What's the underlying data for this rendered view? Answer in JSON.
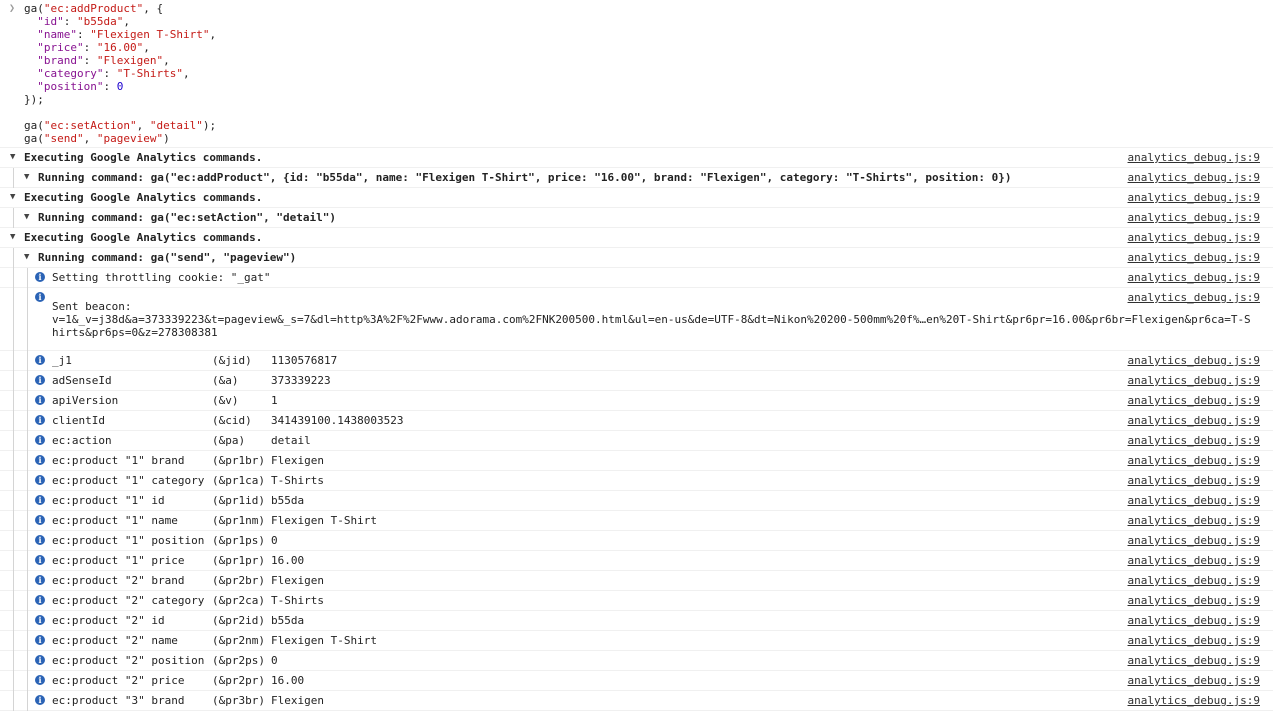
{
  "code_lines": [
    [
      {
        "t": "ga(",
        "c": "plain"
      },
      {
        "t": "\"ec:addProduct\"",
        "c": "str"
      },
      {
        "t": ", {",
        "c": "plain"
      }
    ],
    [
      {
        "t": "  ",
        "c": "plain"
      },
      {
        "t": "\"id\"",
        "c": "key"
      },
      {
        "t": ": ",
        "c": "plain"
      },
      {
        "t": "\"b55da\"",
        "c": "str"
      },
      {
        "t": ",",
        "c": "plain"
      }
    ],
    [
      {
        "t": "  ",
        "c": "plain"
      },
      {
        "t": "\"name\"",
        "c": "key"
      },
      {
        "t": ": ",
        "c": "plain"
      },
      {
        "t": "\"Flexigen T-Shirt\"",
        "c": "str"
      },
      {
        "t": ",",
        "c": "plain"
      }
    ],
    [
      {
        "t": "  ",
        "c": "plain"
      },
      {
        "t": "\"price\"",
        "c": "key"
      },
      {
        "t": ": ",
        "c": "plain"
      },
      {
        "t": "\"16.00\"",
        "c": "str"
      },
      {
        "t": ",",
        "c": "plain"
      }
    ],
    [
      {
        "t": "  ",
        "c": "plain"
      },
      {
        "t": "\"brand\"",
        "c": "key"
      },
      {
        "t": ": ",
        "c": "plain"
      },
      {
        "t": "\"Flexigen\"",
        "c": "str"
      },
      {
        "t": ",",
        "c": "plain"
      }
    ],
    [
      {
        "t": "  ",
        "c": "plain"
      },
      {
        "t": "\"category\"",
        "c": "key"
      },
      {
        "t": ": ",
        "c": "plain"
      },
      {
        "t": "\"T-Shirts\"",
        "c": "str"
      },
      {
        "t": ",",
        "c": "plain"
      }
    ],
    [
      {
        "t": "  ",
        "c": "plain"
      },
      {
        "t": "\"position\"",
        "c": "key"
      },
      {
        "t": ": ",
        "c": "plain"
      },
      {
        "t": "0",
        "c": "num"
      }
    ],
    [
      {
        "t": "});",
        "c": "plain"
      }
    ],
    [
      {
        "t": "",
        "c": "plain"
      }
    ],
    [
      {
        "t": "ga(",
        "c": "plain"
      },
      {
        "t": "\"ec:setAction\"",
        "c": "str"
      },
      {
        "t": ", ",
        "c": "plain"
      },
      {
        "t": "\"detail\"",
        "c": "str"
      },
      {
        "t": ");",
        "c": "plain"
      }
    ],
    [
      {
        "t": "ga(",
        "c": "plain"
      },
      {
        "t": "\"send\"",
        "c": "str"
      },
      {
        "t": ", ",
        "c": "plain"
      },
      {
        "t": "\"pageview\"",
        "c": "str"
      },
      {
        "t": ")",
        "c": "plain"
      }
    ]
  ],
  "source_link": "analytics_debug.js:9",
  "rows": [
    {
      "kind": "group",
      "level": 0,
      "text": "Executing Google Analytics commands."
    },
    {
      "kind": "group",
      "level": 1,
      "text": "Running command: ga(\"ec:addProduct\", {id: \"b55da\", name: \"Flexigen T-Shirt\", price: \"16.00\", brand: \"Flexigen\", category: \"T-Shirts\", position: 0})"
    },
    {
      "kind": "group",
      "level": 0,
      "text": "Executing Google Analytics commands."
    },
    {
      "kind": "group",
      "level": 1,
      "text": "Running command: ga(\"ec:setAction\", \"detail\")"
    },
    {
      "kind": "group",
      "level": 0,
      "text": "Executing Google Analytics commands."
    },
    {
      "kind": "group",
      "level": 1,
      "text": "Running command: ga(\"send\", \"pageview\")"
    },
    {
      "kind": "info",
      "text": "Setting throttling cookie: \"_gat\""
    },
    {
      "kind": "beacon",
      "label": "Sent beacon:",
      "text": "v=1&_v=j38d&a=373339223&t=pageview&_s=7&dl=http%3A%2F%2Fwww.adorama.com%2FNK200500.html&ul=en-us&de=UTF-8&dt=Nikon%20200-500mm%20f%…en%20T-Shirt&pr6pr=16.00&pr6br=Flexigen&pr6ca=T-Shirts&pr6ps=0&z=278308381"
    },
    {
      "kind": "param",
      "name": "_j1",
      "param": "(&jid)",
      "value": "1130576817"
    },
    {
      "kind": "param",
      "name": "adSenseId",
      "param": "(&a)",
      "value": "373339223"
    },
    {
      "kind": "param",
      "name": "apiVersion",
      "param": "(&v)",
      "value": "1"
    },
    {
      "kind": "param",
      "name": "clientId",
      "param": "(&cid)",
      "value": "341439100.1438003523"
    },
    {
      "kind": "param",
      "name": "ec:action",
      "param": "(&pa)",
      "value": "detail"
    },
    {
      "kind": "param",
      "name": "ec:product \"1\" brand",
      "param": "(&pr1br)",
      "value": "Flexigen"
    },
    {
      "kind": "param",
      "name": "ec:product \"1\" category",
      "param": "(&pr1ca)",
      "value": "T-Shirts"
    },
    {
      "kind": "param",
      "name": "ec:product \"1\" id",
      "param": "(&pr1id)",
      "value": "b55da"
    },
    {
      "kind": "param",
      "name": "ec:product \"1\" name",
      "param": "(&pr1nm)",
      "value": "Flexigen T-Shirt"
    },
    {
      "kind": "param",
      "name": "ec:product \"1\" position",
      "param": "(&pr1ps)",
      "value": "0"
    },
    {
      "kind": "param",
      "name": "ec:product \"1\" price",
      "param": "(&pr1pr)",
      "value": "16.00"
    },
    {
      "kind": "param",
      "name": "ec:product \"2\" brand",
      "param": "(&pr2br)",
      "value": "Flexigen"
    },
    {
      "kind": "param",
      "name": "ec:product \"2\" category",
      "param": "(&pr2ca)",
      "value": "T-Shirts"
    },
    {
      "kind": "param",
      "name": "ec:product \"2\" id",
      "param": "(&pr2id)",
      "value": "b55da"
    },
    {
      "kind": "param",
      "name": "ec:product \"2\" name",
      "param": "(&pr2nm)",
      "value": "Flexigen T-Shirt"
    },
    {
      "kind": "param",
      "name": "ec:product \"2\" position",
      "param": "(&pr2ps)",
      "value": "0"
    },
    {
      "kind": "param",
      "name": "ec:product \"2\" price",
      "param": "(&pr2pr)",
      "value": "16.00"
    },
    {
      "kind": "param",
      "name": "ec:product \"3\" brand",
      "param": "(&pr3br)",
      "value": "Flexigen"
    }
  ],
  "icons": {
    "expanded": "triangle-down",
    "prompt": "chevron-right",
    "info": "info-circle"
  },
  "colors": {
    "string": "#c41a16",
    "key": "#881391",
    "number": "#1c00cf",
    "info": "#2b63b5"
  }
}
